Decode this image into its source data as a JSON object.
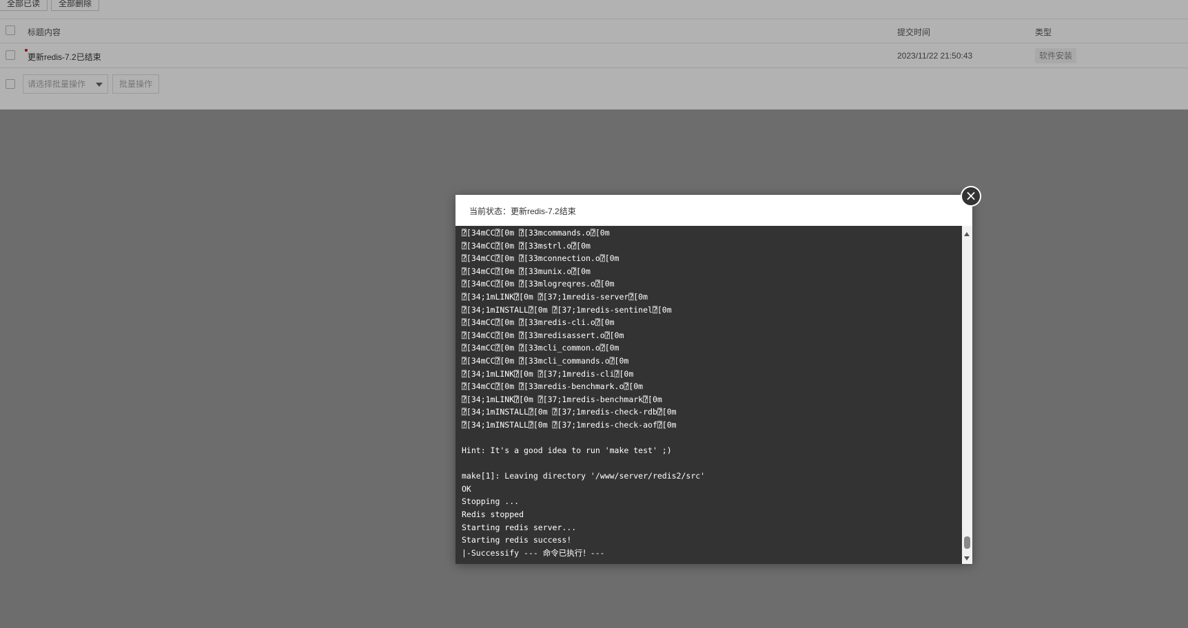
{
  "toolbar": {
    "mark_all_read": "全部已读",
    "delete_all": "全部删除"
  },
  "table": {
    "headers": {
      "title": "标题内容",
      "time": "提交时间",
      "type": "类型"
    },
    "rows": [
      {
        "title": "更新redis-7.2已结束",
        "time": "2023/11/22 21:50:43",
        "type": "软件安装",
        "unread": true
      }
    ]
  },
  "batch": {
    "select_placeholder": "请选择批量操作",
    "button": "批量操作"
  },
  "modal": {
    "title": "当前状态：更新redis-7.2结束",
    "close_icon": "close-icon",
    "log": [
      "⍰[34mCC⍰[0m ⍰[33mcommands.o⍰[0m",
      "⍰[34mCC⍰[0m ⍰[33mstrl.o⍰[0m",
      "⍰[34mCC⍰[0m ⍰[33mconnection.o⍰[0m",
      "⍰[34mCC⍰[0m ⍰[33munix.o⍰[0m",
      "⍰[34mCC⍰[0m ⍰[33mlogreqres.o⍰[0m",
      "⍰[34;1mLINK⍰[0m ⍰[37;1mredis-server⍰[0m",
      "⍰[34;1mINSTALL⍰[0m ⍰[37;1mredis-sentinel⍰[0m",
      "⍰[34mCC⍰[0m ⍰[33mredis-cli.o⍰[0m",
      "⍰[34mCC⍰[0m ⍰[33mredisassert.o⍰[0m",
      "⍰[34mCC⍰[0m ⍰[33mcli_common.o⍰[0m",
      "⍰[34mCC⍰[0m ⍰[33mcli_commands.o⍰[0m",
      "⍰[34;1mLINK⍰[0m ⍰[37;1mredis-cli⍰[0m",
      "⍰[34mCC⍰[0m ⍰[33mredis-benchmark.o⍰[0m",
      "⍰[34;1mLINK⍰[0m ⍰[37;1mredis-benchmark⍰[0m",
      "⍰[34;1mINSTALL⍰[0m ⍰[37;1mredis-check-rdb⍰[0m",
      "⍰[34;1mINSTALL⍰[0m ⍰[37;1mredis-check-aof⍰[0m",
      "",
      "Hint: It's a good idea to run 'make test' ;)",
      "",
      "make[1]: Leaving directory '/www/server/redis2/src'",
      "OK",
      "Stopping ...",
      "Redis stopped",
      "Starting redis server...",
      "Starting redis success!",
      "|-Successify --- 命令已执行！---"
    ]
  }
}
